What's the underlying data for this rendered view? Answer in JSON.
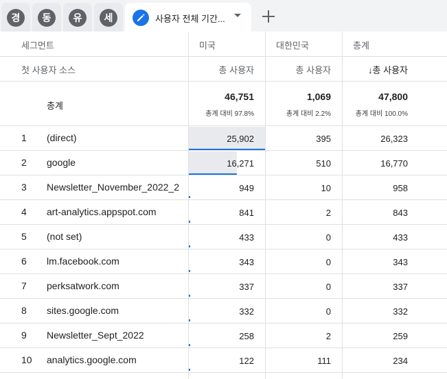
{
  "tabs": {
    "segments": [
      {
        "letter": "경"
      },
      {
        "letter": "동"
      },
      {
        "letter": "유"
      },
      {
        "letter": "세"
      }
    ],
    "active_label": "사용자 전체 기간...",
    "add_label": "+"
  },
  "table": {
    "header": {
      "segment_label": "세그먼트",
      "col_us": "미국",
      "col_kr": "대한민국",
      "col_total": "총계"
    },
    "subheader": {
      "dimension": "첫 사용자 소스",
      "metric_us": "총 사용자",
      "metric_kr": "총 사용자",
      "metric_total": "↓총 사용자"
    },
    "totals": {
      "label": "총계",
      "us_value": "46,751",
      "us_pct": "총계 대비 97.8%",
      "kr_value": "1,069",
      "kr_pct": "총계 대비 2.2%",
      "total_value": "47,800",
      "total_pct": "총계 대비 100.0%"
    },
    "rows": [
      {
        "rank": "1",
        "source": "(direct)",
        "us": "25,902",
        "kr": "395",
        "total": "26,323",
        "us_share": 0.554
      },
      {
        "rank": "2",
        "source": "google",
        "us": "16,271",
        "kr": "510",
        "total": "16,770",
        "us_share": 0.348
      },
      {
        "rank": "3",
        "source": "Newsletter_November_2022_2",
        "us": "949",
        "kr": "10",
        "total": "958",
        "us_share": 0.02
      },
      {
        "rank": "4",
        "source": "art-analytics.appspot.com",
        "us": "841",
        "kr": "2",
        "total": "843",
        "us_share": 0.018
      },
      {
        "rank": "5",
        "source": "(not set)",
        "us": "433",
        "kr": "0",
        "total": "433",
        "us_share": 0.009
      },
      {
        "rank": "6",
        "source": "lm.facebook.com",
        "us": "343",
        "kr": "0",
        "total": "343",
        "us_share": 0.007
      },
      {
        "rank": "7",
        "source": "perksatwork.com",
        "us": "337",
        "kr": "0",
        "total": "337",
        "us_share": 0.007
      },
      {
        "rank": "8",
        "source": "sites.google.com",
        "us": "332",
        "kr": "0",
        "total": "332",
        "us_share": 0.007
      },
      {
        "rank": "9",
        "source": "Newsletter_Sept_2022",
        "us": "258",
        "kr": "2",
        "total": "259",
        "us_share": 0.006
      },
      {
        "rank": "10",
        "source": "analytics.google.com",
        "us": "122",
        "kr": "111",
        "total": "234",
        "us_share": 0.003
      }
    ]
  },
  "colors": {
    "accent": "#1a73e8",
    "chip": "#5f6368",
    "bar": "#e8eaed",
    "grid": "#e0e0e0",
    "kr_marker": "#c2185b"
  }
}
